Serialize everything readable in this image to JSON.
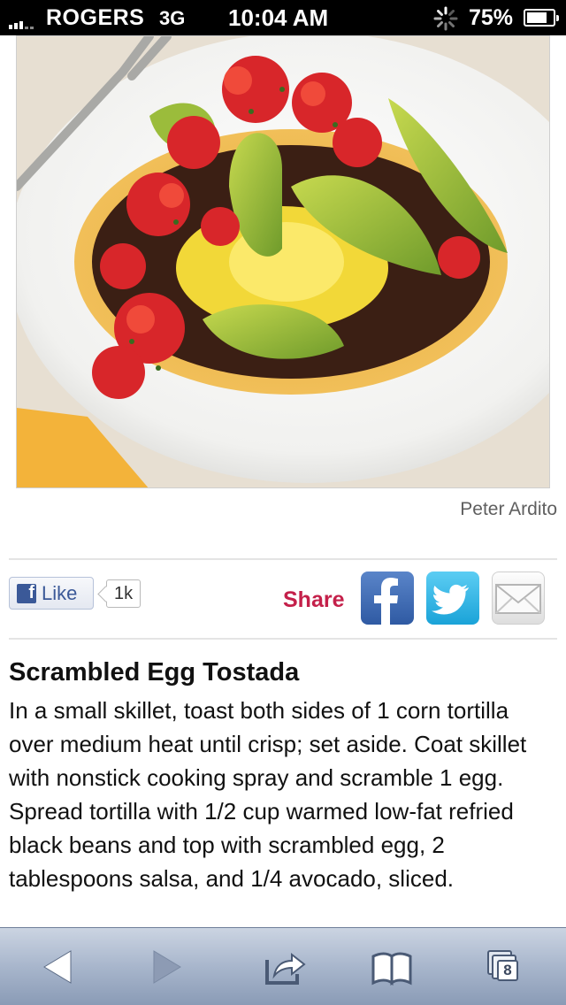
{
  "status_bar": {
    "carrier": "ROGERS",
    "network": "3G",
    "time": "10:04 AM",
    "battery": "75%"
  },
  "photo": {
    "credit": "Peter Ardito"
  },
  "social": {
    "like_label": "Like",
    "like_count": "1k",
    "share_label": "Share",
    "facebook_glyph": "f",
    "icons": [
      "facebook-icon",
      "twitter-icon",
      "mail-icon"
    ]
  },
  "recipe": {
    "title": "Scrambled Egg Tostada",
    "body": "In a small skillet, toast both sides of 1 corn tortilla over medium heat until crisp; set aside. Coat skillet with nonstick cooking spray and scramble 1 egg. Spread tortilla with 1/2 cup warmed low-fat refried black beans and top with scrambled egg, 2 tablespoons salsa, and 1/4 avocado, sliced."
  },
  "toolbar": {
    "tab_count": "8",
    "buttons": [
      "back",
      "forward",
      "share",
      "bookmarks",
      "tabs"
    ]
  },
  "colors": {
    "share_label": "#c4204a",
    "facebook": "#3b5998",
    "twitter": "#1aa3d8",
    "toolbar": "#a8b6cc"
  }
}
